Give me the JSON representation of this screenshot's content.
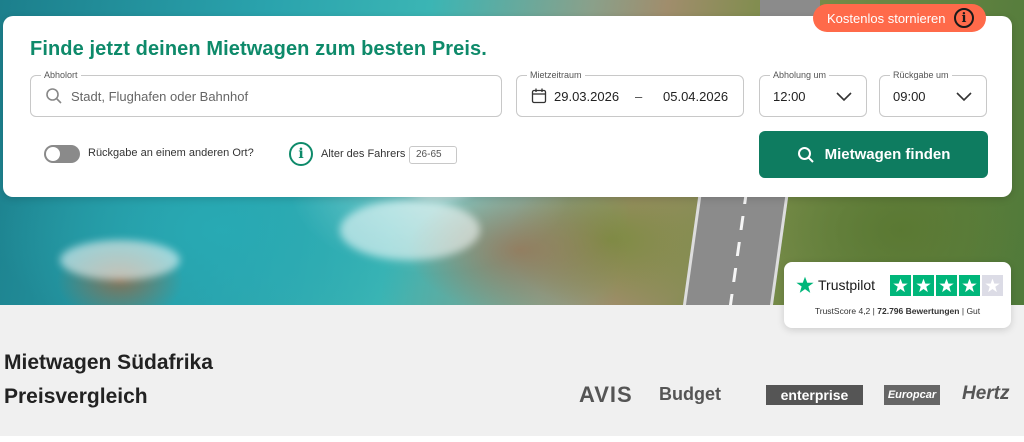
{
  "search": {
    "heading": "Finde jetzt deinen Mietwagen zum besten Preis.",
    "cancel_badge": "Kostenlos stornieren",
    "pickup": {
      "label": "Abholort",
      "placeholder": "Stadt, Flughafen oder Bahnhof"
    },
    "period": {
      "label": "Mietzeitraum",
      "start": "29.03.2026",
      "separator": "–",
      "end": "05.04.2026"
    },
    "pickup_time": {
      "label": "Abholung um",
      "value": "12:00"
    },
    "return_time": {
      "label": "Rückgabe um",
      "value": "09:00"
    },
    "return_elsewhere": "Rückgabe an einem anderen Ort?",
    "driver_age": {
      "label": "Alter des Fahrers",
      "value": "26-65"
    },
    "submit_label": "Mietwagen finden"
  },
  "trustpilot": {
    "brand": "Trustpilot",
    "rating_stars": 4,
    "max_stars": 5,
    "score_text": "TrustScore 4,2",
    "sep1": "|",
    "reviews": "72.796 Bewertungen",
    "sep2": "|",
    "verdict": "Gut"
  },
  "section": {
    "title_line1": "Mietwagen Südafrika",
    "title_line2": "Preisvergleich"
  },
  "partners": [
    "AVIS",
    "Budget",
    "enterprise",
    "Europcar",
    "Hertz"
  ],
  "colors": {
    "brand_green": "#0e8a6a",
    "button_green": "#0e7c60",
    "badge_orange": "#ff6a4a",
    "trustpilot_green": "#00b67a"
  },
  "icons": {
    "pickup": "search-icon",
    "period": "calendar-icon",
    "time": "chevron-down-icon",
    "info": "info-icon",
    "submit": "search-icon",
    "trustpilot": "star-icon"
  }
}
